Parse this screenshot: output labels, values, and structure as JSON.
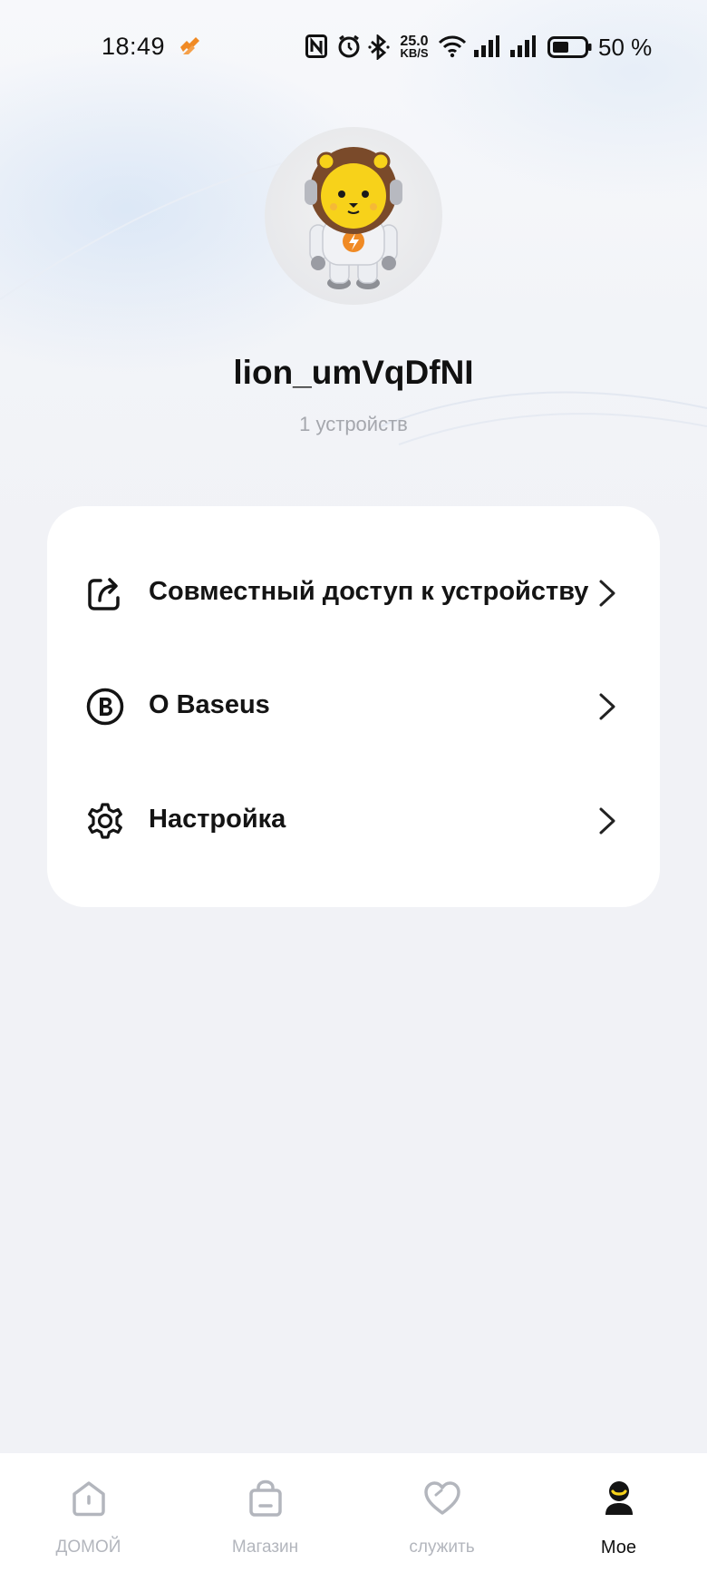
{
  "status_bar": {
    "time": "18:49",
    "network_speed_value": "25.0",
    "network_speed_unit": "KB/S",
    "battery_percent": "50 %",
    "icons": [
      "flame-icon",
      "nfc-icon",
      "alarm-icon",
      "bluetooth-icon",
      "wifi-icon",
      "signal-icon",
      "signal-icon",
      "battery-icon"
    ]
  },
  "profile": {
    "username": "lion_umVqDfNI",
    "device_count": "1 устройств",
    "avatar_icon": "lion-astronaut-avatar"
  },
  "menu": {
    "items": [
      {
        "label": "Совместный доступ к устройству",
        "icon": "share-icon"
      },
      {
        "label": "О Baseus",
        "icon": "baseus-logo-icon"
      },
      {
        "label": "Настройка",
        "icon": "gear-icon"
      }
    ]
  },
  "bottom_nav": {
    "items": [
      {
        "label": "ДОМОЙ",
        "icon": "home-icon",
        "active": false
      },
      {
        "label": "Магазин",
        "icon": "shopping-bag-icon",
        "active": false
      },
      {
        "label": "служить",
        "icon": "heart-icon",
        "active": false
      },
      {
        "label": "Мое",
        "icon": "profile-icon",
        "active": true
      }
    ]
  },
  "colors": {
    "background": "#f1f2f6",
    "card": "#ffffff",
    "text_primary": "#141414",
    "text_secondary": "#a5a7ad",
    "nav_inactive": "#b3b6bd",
    "accent_orange": "#f08a24",
    "accent_yellow": "#f7d21a"
  }
}
